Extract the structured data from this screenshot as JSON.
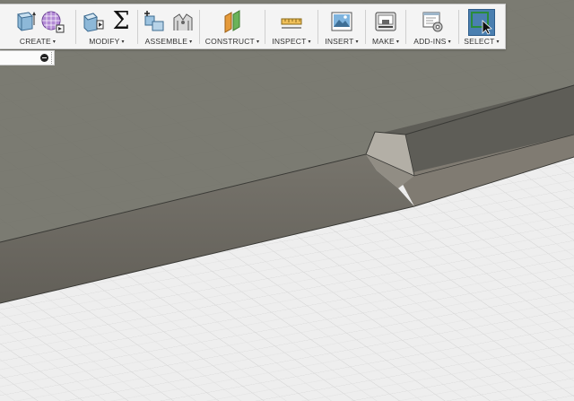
{
  "toolbar": {
    "groups": [
      {
        "label": "CREATE",
        "icons": [
          "box-extrude-icon",
          "sphere-mesh-icon"
        ]
      },
      {
        "label": "MODIFY",
        "icons": [
          "press-pull-icon",
          "sigma-icon"
        ]
      },
      {
        "label": "ASSEMBLE",
        "icons": [
          "new-component-icon",
          "joint-icon"
        ]
      },
      {
        "label": "CONSTRUCT",
        "icons": [
          "offset-plane-icon"
        ]
      },
      {
        "label": "INSPECT",
        "icons": [
          "measure-icon"
        ]
      },
      {
        "label": "INSERT",
        "icons": [
          "insert-image-icon"
        ]
      },
      {
        "label": "MAKE",
        "icons": [
          "3d-print-icon"
        ]
      },
      {
        "label": "ADD-INS",
        "icons": [
          "scripts-addins-icon"
        ]
      },
      {
        "label": "SELECT",
        "icons": [
          "select-cursor-icon"
        ],
        "active": true
      }
    ],
    "sigma_glyph": "Σ",
    "caret": "▾"
  },
  "colors": {
    "top_face": "#7a7a71",
    "front_face": "#6d6a63",
    "grid_bg": "#eeeeee",
    "grid_line": "#d0d0d0",
    "select_accent": "#4a7fb0"
  }
}
